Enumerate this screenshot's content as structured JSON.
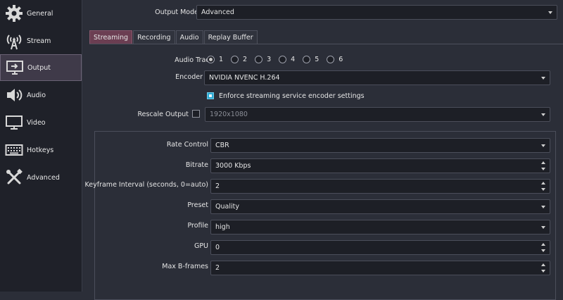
{
  "sidebar": {
    "items": [
      {
        "label": "General",
        "icon": "gear-icon"
      },
      {
        "label": "Stream",
        "icon": "broadcast-icon"
      },
      {
        "label": "Output",
        "icon": "monitor-output-icon",
        "active": true
      },
      {
        "label": "Audio",
        "icon": "speaker-icon"
      },
      {
        "label": "Video",
        "icon": "monitor-icon"
      },
      {
        "label": "Hotkeys",
        "icon": "keyboard-icon"
      },
      {
        "label": "Advanced",
        "icon": "tools-icon"
      }
    ]
  },
  "output_mode": {
    "label": "Output Mode",
    "value": "Advanced"
  },
  "tabs": [
    {
      "label": "Streaming",
      "active": true
    },
    {
      "label": "Recording"
    },
    {
      "label": "Audio"
    },
    {
      "label": "Replay Buffer"
    }
  ],
  "audio_track": {
    "label": "Audio Track",
    "options": [
      "1",
      "2",
      "3",
      "4",
      "5",
      "6"
    ],
    "selected": "1"
  },
  "encoder": {
    "label": "Encoder",
    "value": "NVIDIA NVENC H.264"
  },
  "enforce": {
    "label": "Enforce streaming service encoder settings",
    "checked": true
  },
  "rescale": {
    "label": "Rescale Output",
    "value": "1920x1080",
    "checked": false
  },
  "settings": {
    "rate_control": {
      "label": "Rate Control",
      "value": "CBR"
    },
    "bitrate": {
      "label": "Bitrate",
      "value": "3000 Kbps"
    },
    "keyframe": {
      "label": "Keyframe Interval (seconds, 0=auto)",
      "value": "2"
    },
    "preset": {
      "label": "Preset",
      "value": "Quality"
    },
    "profile": {
      "label": "Profile",
      "value": "high"
    },
    "gpu": {
      "label": "GPU",
      "value": "0"
    },
    "bframes": {
      "label": "Max B-frames",
      "value": "2"
    }
  },
  "colors": {
    "accent": "#2aa9d4",
    "active_tab": "#6b3e52",
    "background": "#2b2e38"
  }
}
